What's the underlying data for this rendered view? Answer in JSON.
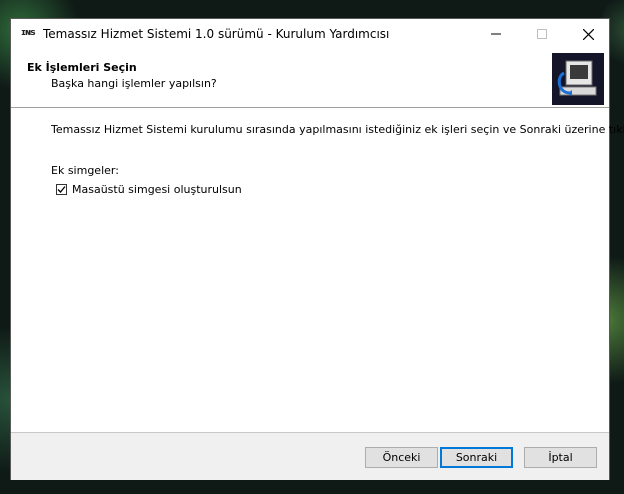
{
  "window": {
    "app_icon_text": "ɪɴs",
    "title": "Temassız Hizmet Sistemi 1.0 sürümü - Kurulum Yardımcısı"
  },
  "header": {
    "title": "Ek İşlemleri Seçin",
    "subtitle": "Başka hangi işlemler yapılsın?"
  },
  "main": {
    "description": "Temassız Hizmet Sistemi kurulumu sırasında yapılmasını istediğiniz ek işleri seçin ve Sonraki üzerine tıklayın.",
    "group_label": "Ek simgeler:",
    "checkbox": {
      "label": "Masaüstü simgesi oluşturulsun",
      "checked": true
    }
  },
  "footer": {
    "back_label": "Önceki",
    "next_label": "Sonraki",
    "cancel_label": "İptal"
  },
  "colors": {
    "accent": "#0078d7",
    "footer_bg": "#f0f0f0",
    "wizard_image_bg": "#151529"
  }
}
